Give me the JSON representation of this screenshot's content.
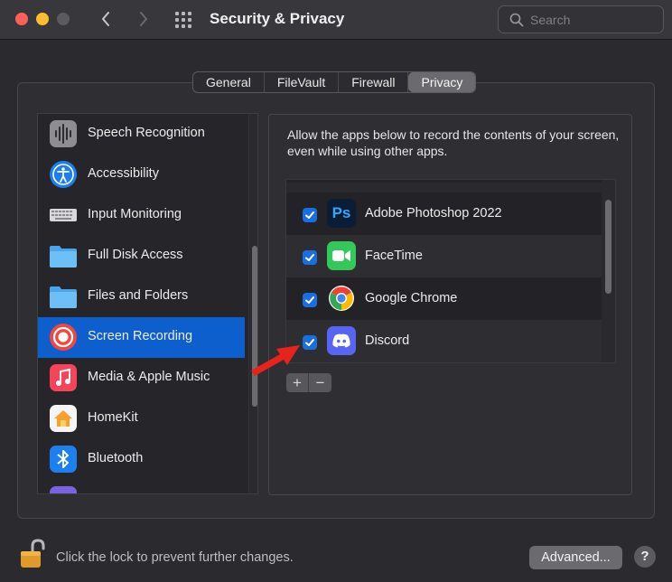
{
  "window": {
    "title": "Security & Privacy",
    "search_placeholder": "Search"
  },
  "tabs": [
    {
      "label": "General",
      "active": false
    },
    {
      "label": "FileVault",
      "active": false
    },
    {
      "label": "Firewall",
      "active": false
    },
    {
      "label": "Privacy",
      "active": true
    }
  ],
  "sidebar": {
    "items": [
      {
        "label": "Speech Recognition",
        "icon": "waveform-icon"
      },
      {
        "label": "Accessibility",
        "icon": "accessibility-icon"
      },
      {
        "label": "Input Monitoring",
        "icon": "keyboard-icon"
      },
      {
        "label": "Full Disk Access",
        "icon": "folder-icon"
      },
      {
        "label": "Files and Folders",
        "icon": "folder-icon"
      },
      {
        "label": "Screen Recording",
        "icon": "screen-record-icon",
        "selected": true
      },
      {
        "label": "Media & Apple Music",
        "icon": "music-note-icon"
      },
      {
        "label": "HomeKit",
        "icon": "home-icon"
      },
      {
        "label": "Bluetooth",
        "icon": "bluetooth-icon"
      }
    ]
  },
  "main": {
    "description": "Allow the apps below to record the contents of your screen, even while using other apps.",
    "apps": [
      {
        "label": "Adobe Photoshop 2022",
        "checked": true,
        "icon": "photoshop-icon"
      },
      {
        "label": "FaceTime",
        "checked": true,
        "icon": "facetime-icon"
      },
      {
        "label": "Google Chrome",
        "checked": true,
        "icon": "chrome-icon"
      },
      {
        "label": "Discord",
        "checked": true,
        "icon": "discord-icon"
      }
    ],
    "add_label": "+",
    "remove_label": "−"
  },
  "footer": {
    "lock_text": "Click the lock to prevent further changes.",
    "advanced_label": "Advanced...",
    "help_label": "?"
  },
  "colors": {
    "accent": "#0c5fcd",
    "checkbox": "#1a6fe0",
    "annotation_arrow": "#e8231c"
  }
}
